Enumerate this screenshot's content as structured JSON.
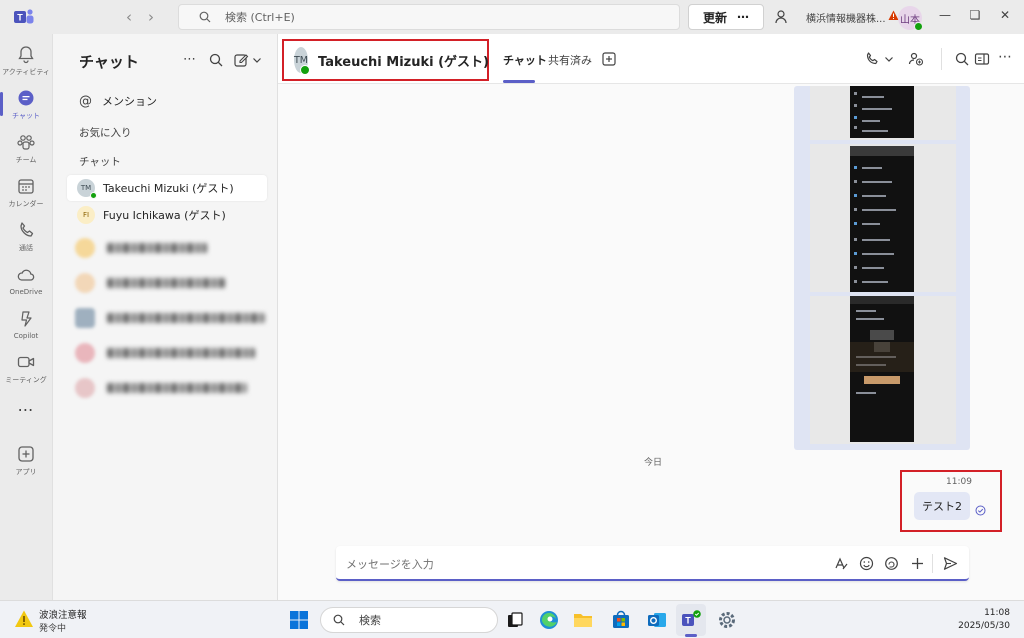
{
  "titlebar": {
    "search_placeholder": "検索 (Ctrl+E)",
    "update_label": "更新",
    "update_more": "⋯",
    "org_name": "横浜情報機器株...",
    "user_initials": "山本"
  },
  "rail": {
    "items": [
      {
        "label": "アクティビティ"
      },
      {
        "label": "チャット"
      },
      {
        "label": "チーム"
      },
      {
        "label": "カレンダー"
      },
      {
        "label": "通話"
      },
      {
        "label": "OneDrive"
      },
      {
        "label": "Copilot"
      },
      {
        "label": "ミーティング"
      },
      {
        "label": "アプリ"
      }
    ]
  },
  "chatlist": {
    "title": "チャット",
    "mentions": "メンション",
    "favorites": "お気に入り",
    "chats_section": "チャット",
    "contacts": [
      {
        "initials": "TM",
        "name": "Takeuchi Mizuki (ゲスト)"
      },
      {
        "initials": "FI",
        "name": "Fuyu Ichikawa (ゲスト)"
      }
    ]
  },
  "conversation": {
    "initials": "TM",
    "name": "Takeuchi Mizuki (ゲスト)",
    "tabs": [
      "チャット",
      "共有済み"
    ],
    "date_divider": "今日",
    "message_time": "11:09",
    "message_text": "テスト2",
    "compose_placeholder": "メッセージを入力"
  },
  "taskbar": {
    "weather_title": "波浪注意報",
    "weather_status": "発令中",
    "search_label": "検索",
    "time": "11:08",
    "date": "2025/05/30"
  },
  "colors": {
    "accent": "#5b5fc7",
    "highlight_box": "#d32027",
    "presence": "#13a10e"
  }
}
